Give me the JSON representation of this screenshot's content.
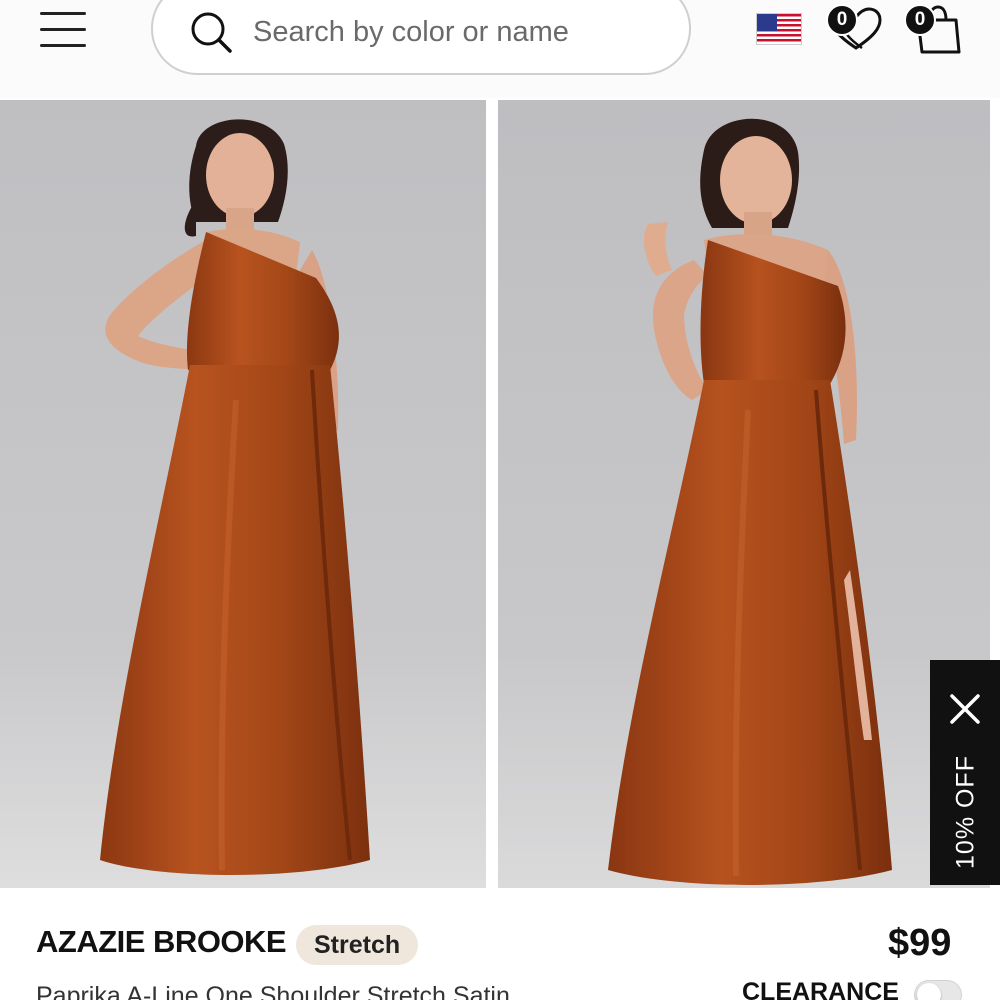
{
  "header": {
    "search": {
      "placeholder": "Search by color or name"
    },
    "wishlist": {
      "count": "0"
    },
    "cart": {
      "count": "0"
    },
    "locale_flag": "us-flag-icon"
  },
  "gallery": {
    "images": [
      {
        "name": "product-photo-front"
      },
      {
        "name": "product-photo-pose"
      }
    ],
    "dress_color": "#a84a1c",
    "backdrop_color": "#cdcdcf"
  },
  "promo": {
    "label": "10% OFF"
  },
  "product": {
    "brand": "AZAZIE BROOKE",
    "tag": "Stretch",
    "price": "$99",
    "title": "Paprika A-Line One Shoulder Stretch Satin",
    "clearance_label": "CLEARANCE"
  },
  "colors": {
    "accent": "#111111",
    "tag_background": "#efe6dc"
  }
}
